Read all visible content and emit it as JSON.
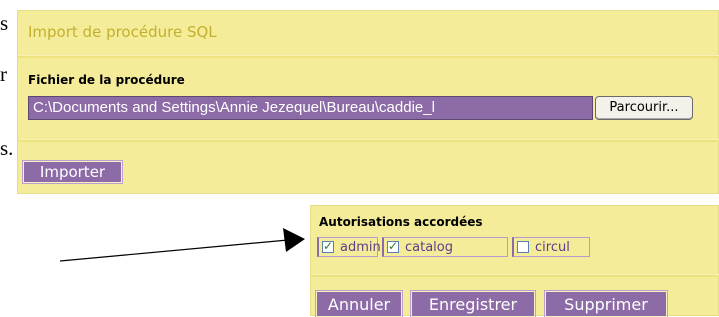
{
  "background_fragments": {
    "line1": "s",
    "line2": "r",
    "line3": "s."
  },
  "import_panel": {
    "title": "Import de procédure SQL",
    "field_label": "Fichier de la procédure",
    "file_path": "C:\\Documents and Settings\\Annie Jezequel\\Bureau\\caddie_l",
    "browse_label": "Parcourir...",
    "import_label": "Importer"
  },
  "auth_panel": {
    "title": "Autorisations accordées",
    "permissions": [
      {
        "label": "admin",
        "checked": true
      },
      {
        "label": "catalog",
        "checked": true
      },
      {
        "label": "circul",
        "checked": false
      }
    ],
    "buttons": {
      "cancel": "Annuler",
      "save": "Enregistrer",
      "delete": "Supprimer"
    }
  },
  "colors": {
    "panel": "#f5ec9a",
    "accent": "#8d6ba7",
    "title": "#c3b02f"
  }
}
